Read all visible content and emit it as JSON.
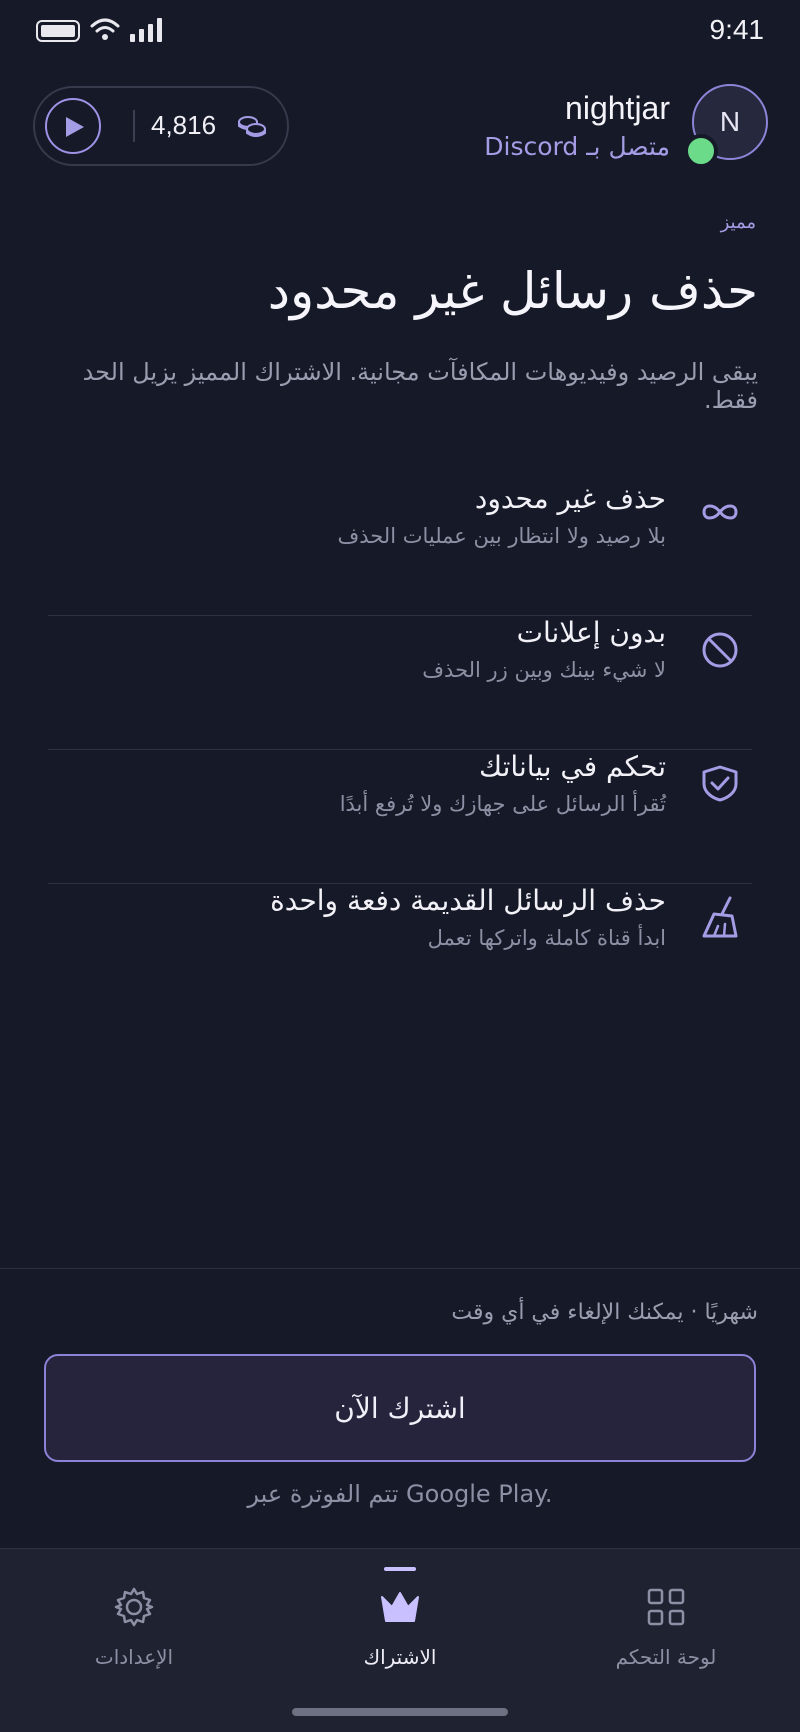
{
  "status_bar": {
    "time": "9:41"
  },
  "header": {
    "coins": "4,816",
    "username": "nightjar",
    "connected_label": "متصل بـ Discord",
    "avatar_initial": "N"
  },
  "hero": {
    "badge": "مميز",
    "title": "حذف رسائل غير محدود",
    "subtitle": "يبقى الرصيد وفيديوهات المكافآت مجانية. الاشتراك المميز يزيل الحد فقط."
  },
  "features": [
    {
      "icon": "infinity-icon",
      "title": "حذف غير محدود",
      "desc": "بلا رصيد ولا انتظار بين عمليات الحذف"
    },
    {
      "icon": "no-ads-icon",
      "title": "بدون إعلانات",
      "desc": "لا شيء بينك وبين زر الحذف"
    },
    {
      "icon": "shield-check-icon",
      "title": "تحكم في بياناتك",
      "desc": "تُقرأ الرسائل على جهازك ولا تُرفع أبدًا"
    },
    {
      "icon": "broom-icon",
      "title": "حذف الرسائل القديمة دفعة واحدة",
      "desc": "ابدأ قناة كاملة واتركها تعمل"
    }
  ],
  "cta": {
    "plan": "شهريًا · يمكنك الإلغاء في أي وقت",
    "button": "اشترك الآن",
    "billing": "تتم الفوترة عبر Google Play."
  },
  "nav": {
    "settings": "الإعدادات",
    "subscription": "الاشتراك",
    "dashboard": "لوحة التحكم"
  },
  "colors": {
    "background": "#161927",
    "accent": "#A59CE6",
    "online": "#6BDB8A"
  }
}
